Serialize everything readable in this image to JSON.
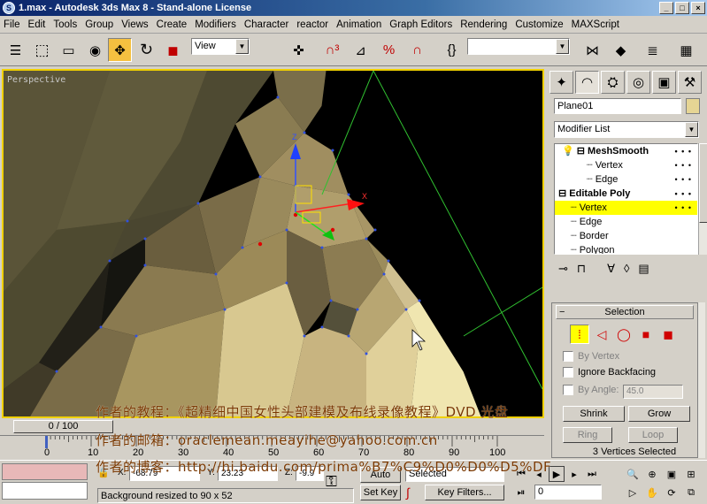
{
  "window": {
    "title": "1.max - Autodesk 3ds Max 8  - Stand-alone License",
    "min": "_",
    "max": "□",
    "close": "×"
  },
  "menu": [
    "File",
    "Edit",
    "Tools",
    "Group",
    "Views",
    "Create",
    "Modifiers",
    "Character",
    "reactor",
    "Animation",
    "Graph Editors",
    "Rendering",
    "Customize",
    "MAXScript"
  ],
  "toolbar": {
    "ref_coord": "View",
    "named_sel": ""
  },
  "viewport": {
    "label": "Perspective"
  },
  "overlay": {
    "line1": "作者的教程：《超精细中国女性头部建模及布线录像教程》DVD 光盘",
    "line2": "作者的邮箱：oraclemean.meayihe@yahoo.com.cn",
    "line3": "作者的博客：http://hi.baidu.com/prima%B7%C9%D0%D0%D5%DF"
  },
  "panel": {
    "object_name": "Plane01",
    "modifier_list": "Modifier List",
    "stack": [
      {
        "label": "MeshSmooth",
        "bold": true,
        "level": 0,
        "sel": false
      },
      {
        "label": "Vertex",
        "bold": false,
        "level": 2,
        "sel": false
      },
      {
        "label": "Edge",
        "bold": false,
        "level": 2,
        "sel": false
      },
      {
        "label": "Editable Poly",
        "bold": true,
        "level": 0,
        "sel": false
      },
      {
        "label": "Vertex",
        "bold": false,
        "level": 1,
        "sel": true
      },
      {
        "label": "Edge",
        "bold": false,
        "level": 1,
        "sel": false
      },
      {
        "label": "Border",
        "bold": false,
        "level": 1,
        "sel": false
      },
      {
        "label": "Polygon",
        "bold": false,
        "level": 1,
        "sel": false
      }
    ],
    "selection": {
      "header": "Selection",
      "by_vertex": "By Vertex",
      "ignore_backfacing": "Ignore Backfacing",
      "by_angle": "By Angle:",
      "angle_value": "45.0",
      "shrink": "Shrink",
      "grow": "Grow",
      "ring": "Ring",
      "loop": "Loop",
      "count": "3 Vertices Selected"
    }
  },
  "timeline": {
    "slider": "0 / 100",
    "ticks": [
      "0",
      "10",
      "20",
      "30",
      "40",
      "50",
      "60",
      "70",
      "80",
      "90",
      "100"
    ]
  },
  "status": {
    "x": "-68.79",
    "y": "23.23",
    "z": "-9.9",
    "x_label": "X:",
    "y_label": "Y:",
    "z_label": "Z:",
    "prompt": "Background resized to 90 x 52",
    "auto_key": "Auto Key",
    "set_key": "Set Key",
    "selected": "Selected",
    "key_filters": "Key Filters...",
    "frame": "0"
  }
}
